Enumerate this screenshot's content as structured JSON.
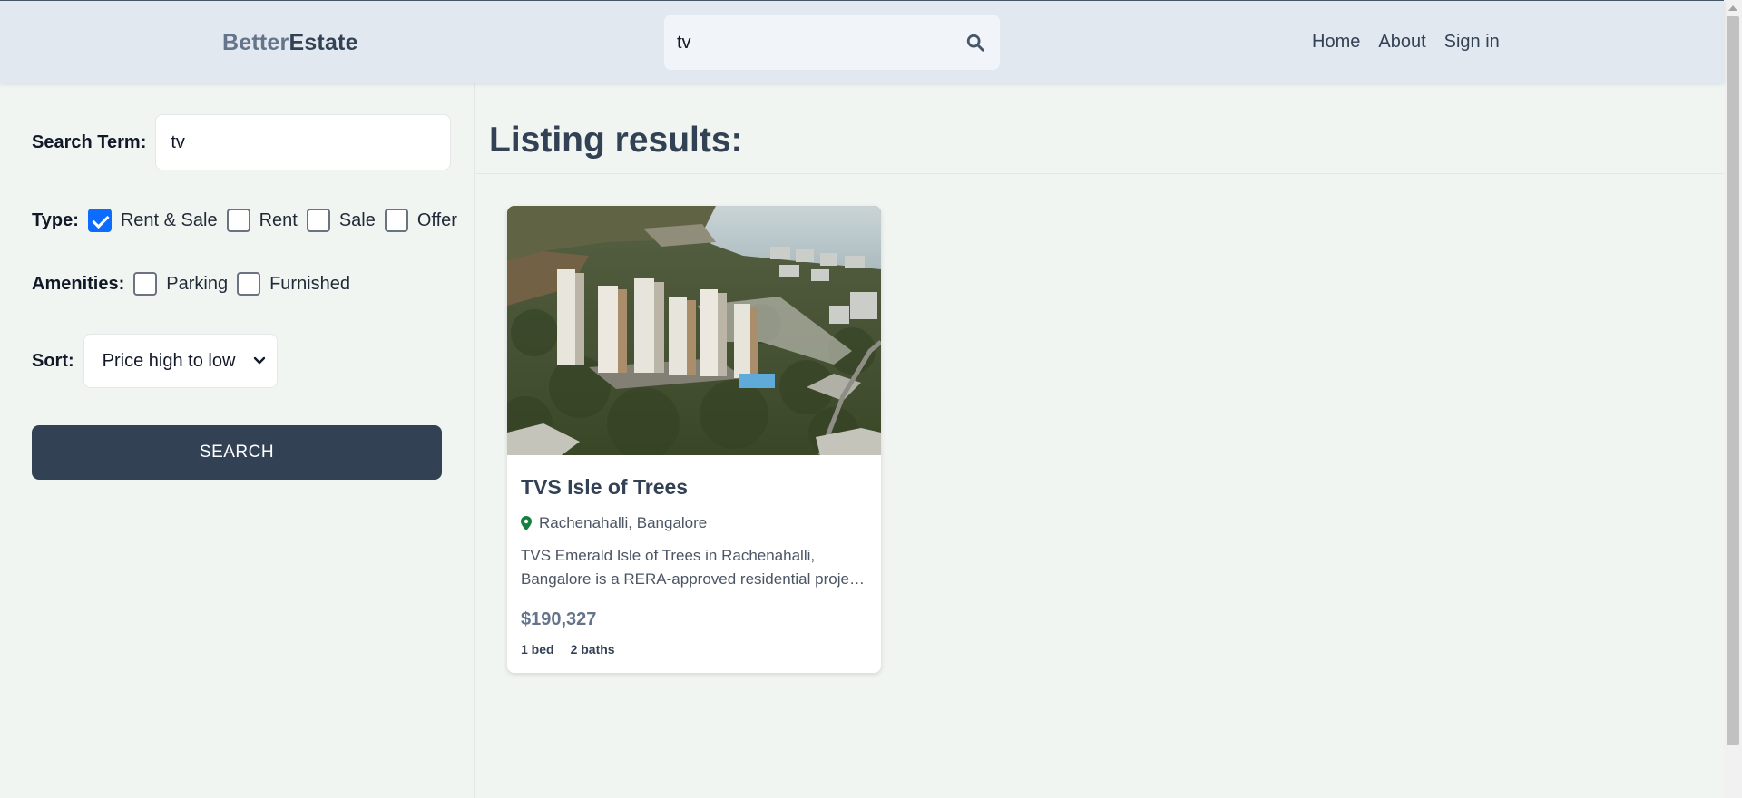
{
  "header": {
    "logo_part1": "Better",
    "logo_part2": "Estate",
    "search_value": "tv",
    "search_icon": "search-icon",
    "nav": [
      "Home",
      "About",
      "Sign in"
    ]
  },
  "sidebar": {
    "search_term_label": "Search Term:",
    "search_term_value": "tv",
    "type_label": "Type:",
    "type_options": [
      {
        "label": "Rent & Sale",
        "checked": true
      },
      {
        "label": "Rent",
        "checked": false
      },
      {
        "label": "Sale",
        "checked": false
      },
      {
        "label": "Offer",
        "checked": false
      }
    ],
    "amenities_label": "Amenities:",
    "amenity_options": [
      {
        "label": "Parking",
        "checked": false
      },
      {
        "label": "Furnished",
        "checked": false
      }
    ],
    "sort_label": "Sort:",
    "sort_value": "Price high to low",
    "search_button": "SEARCH"
  },
  "main": {
    "title": "Listing results:",
    "listings": [
      {
        "title": "TVS Isle of Trees",
        "location": "Rachenahalli, Bangalore",
        "description": "TVS Emerald Isle of Trees in Rachenahalli, Bangalore is a RERA-approved residential project with modern amenities.",
        "price": "$190,327",
        "beds": "1 bed",
        "baths": "2 baths",
        "location_icon": "map-pin-icon"
      }
    ]
  },
  "colors": {
    "header_bg": "#e2e8f0",
    "page_bg": "#f1f5f1",
    "primary": "#334155",
    "muted": "#64748b",
    "checkbox_checked": "#0b6cff",
    "pin": "#15803d"
  }
}
